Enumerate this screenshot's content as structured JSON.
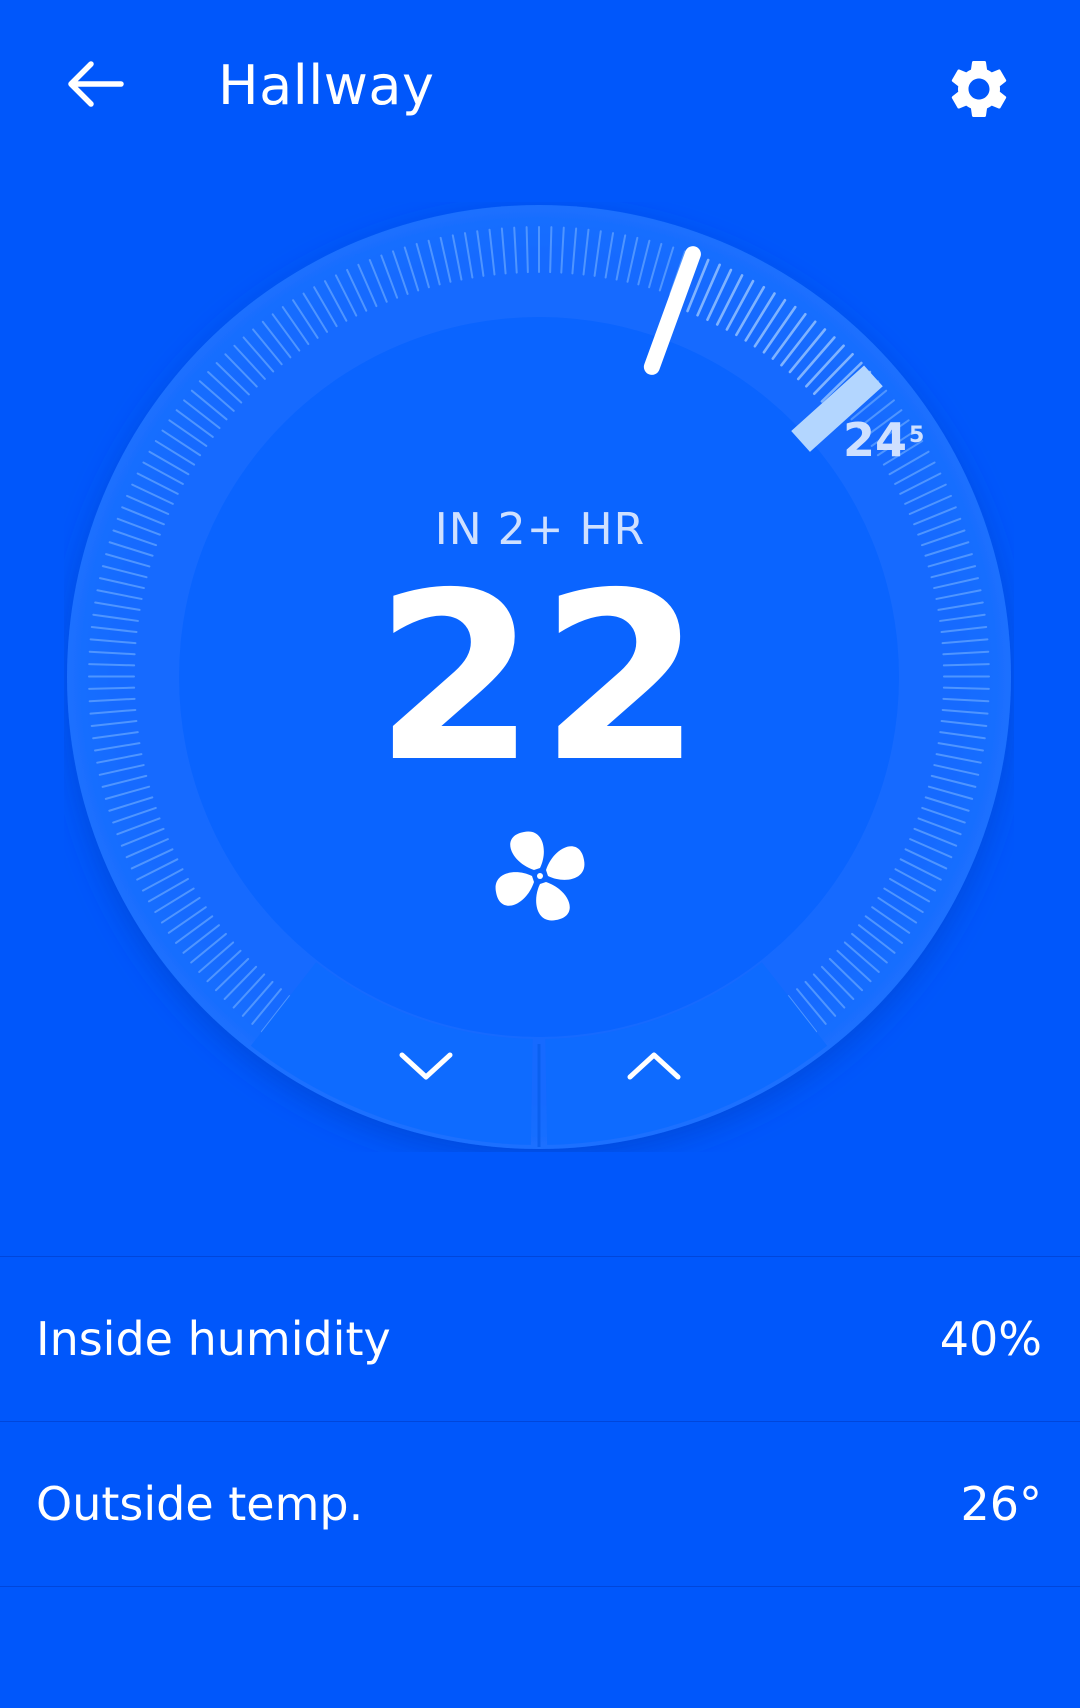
{
  "header": {
    "back_icon": "arrow-left-icon",
    "title": "Hallway",
    "settings_icon": "gear-icon"
  },
  "thermostat": {
    "status": "IN 2+ HR",
    "target_temp": "22",
    "current_temp": "24",
    "current_temp_decimal": "5",
    "mode_icon": "fan-icon",
    "decrease_icon": "chevron-down-icon",
    "increase_icon": "chevron-up-icon"
  },
  "info": {
    "humidity_label": "Inside humidity",
    "humidity_value": "40%",
    "outside_label": "Outside temp.",
    "outside_value": "26°"
  },
  "colors": {
    "background": "#0057fb",
    "dial_face": "#0a66ff",
    "dial_outer": "#1a6cff",
    "tick": "#4f95ff",
    "target_marker": "#ffffff",
    "current_marker": "#b3d6ff"
  }
}
